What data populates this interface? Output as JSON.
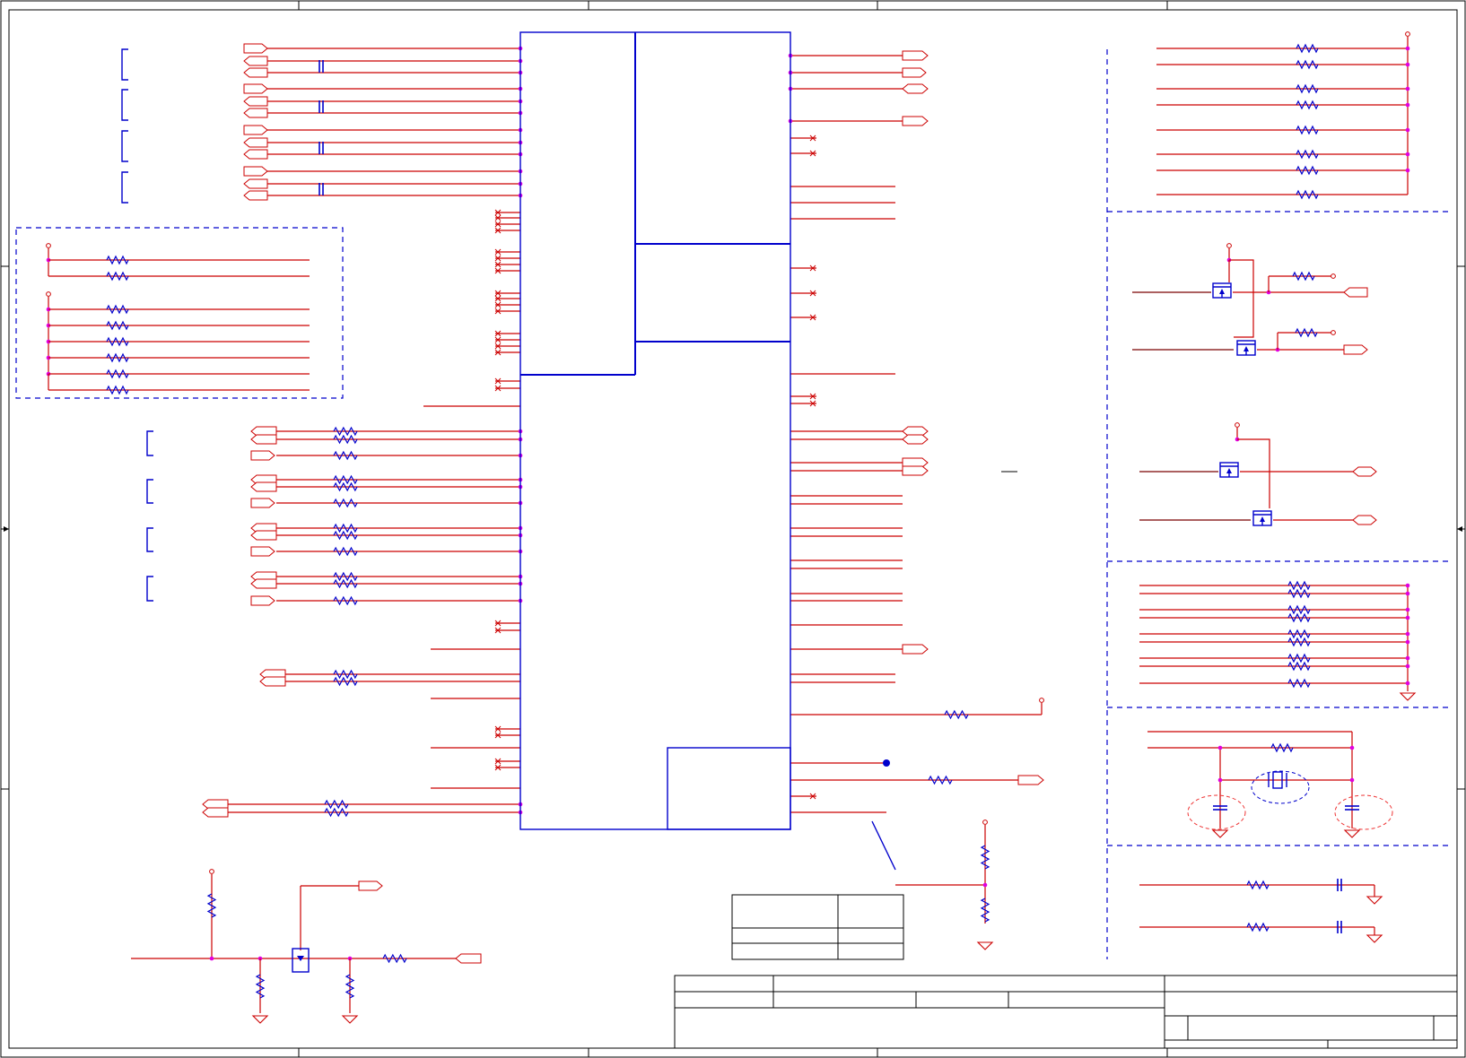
{
  "page": {
    "background": "#ffffff",
    "wire_color": "#cc0000",
    "component_color": "#0000cc",
    "junction_color": "#e000e0",
    "frame_color": "#000000"
  },
  "symbols": [
    "resistor",
    "capacitor",
    "mosfet",
    "crystal",
    "ground",
    "power-pin",
    "off-page-port",
    "no-connect"
  ]
}
